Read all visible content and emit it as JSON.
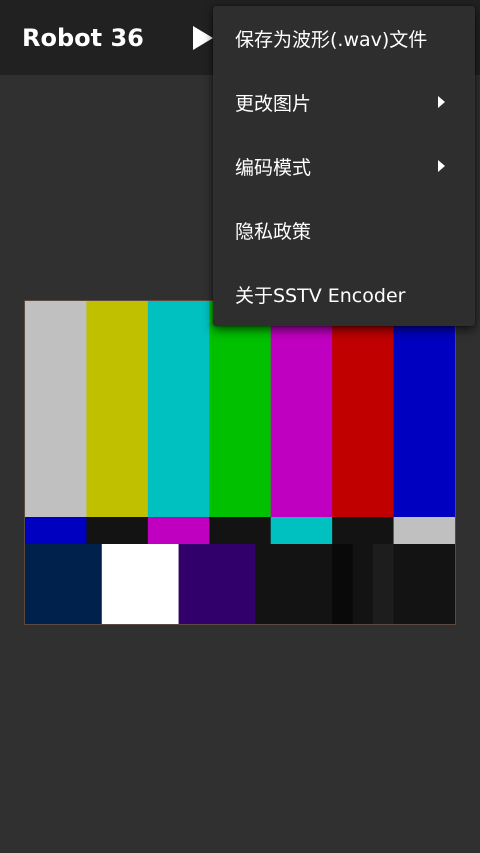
{
  "app_bar": {
    "title": "Robot 36",
    "play_icon": "play-icon"
  },
  "menu": {
    "items": [
      {
        "label": "保存为波形(.wav)文件",
        "has_submenu": false
      },
      {
        "label": "更改图片",
        "has_submenu": true
      },
      {
        "label": "编码模式",
        "has_submenu": true
      },
      {
        "label": "隐私政策",
        "has_submenu": false
      },
      {
        "label": "关于SSTV Encoder",
        "has_submenu": false
      }
    ],
    "submenu_icon": "chevron-right-icon"
  },
  "test_pattern": {
    "image": "smpte-color-bars",
    "top_bars": [
      "#c0c0c0",
      "#c0c000",
      "#00c0c0",
      "#00c000",
      "#c000c0",
      "#c00000",
      "#0000c0"
    ],
    "middle_bars": [
      "#0000c0",
      "#131313",
      "#c000c0",
      "#131313",
      "#00c0c0",
      "#131313",
      "#c0c0c0"
    ],
    "bottom_blocks": [
      "#00214c",
      "#ffffff",
      "#32006a",
      "#131313",
      "#090909",
      "#131313",
      "#1d1d1d",
      "#131313"
    ]
  }
}
